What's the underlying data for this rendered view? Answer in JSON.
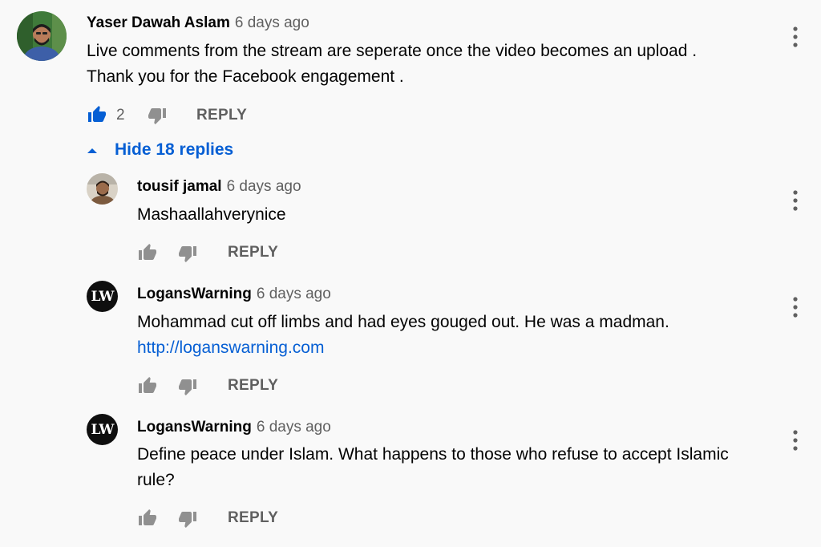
{
  "comment": {
    "author": "Yaser Dawah Aslam",
    "time": "6 days ago",
    "text_line1": "Live comments  from the stream are seperate once the video becomes an upload .",
    "text_line2": "Thank you for the Facebook engagement .",
    "like_count": "2",
    "liked": true,
    "reply_label": "REPLY",
    "toggle_label": "Hide 18 replies"
  },
  "replies": [
    {
      "author": "tousif jamal",
      "time": "6 days ago",
      "text_line1": "Mashaallahverynice",
      "reply_label": "REPLY"
    },
    {
      "author": "LogansWarning",
      "time": "6 days ago",
      "avatar_text": "LW",
      "text_line1": "Mohammad cut off limbs and had eyes gouged out. He was a madman.",
      "link": "http://loganswarning.com",
      "reply_label": "REPLY"
    },
    {
      "author": "LogansWarning",
      "time": "6 days ago",
      "avatar_text": "LW",
      "text_line1": "Define peace under Islam. What happens to those who refuse to accept Islamic",
      "text_line2": "rule?",
      "reply_label": "REPLY"
    }
  ],
  "colors": {
    "background": "#f9f9f9",
    "link_blue": "#065fd4",
    "secondary_text": "#606060"
  }
}
